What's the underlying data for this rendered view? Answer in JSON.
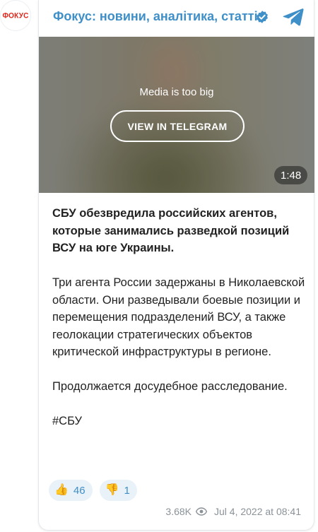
{
  "channel": {
    "name": "Фокус: новини, аналітика, статті",
    "avatar_text": "ФОКУС"
  },
  "media": {
    "notice": "Media is too big",
    "button_label": "VIEW IN TELEGRAM",
    "duration": "1:48"
  },
  "message": {
    "headline": "СБУ обезвредила российских агентов, которые занимались разведкой позиций ВСУ на юге Украины.",
    "paragraph1": "Три агента России задержаны в Николаевской области. Они разведывали боевые позиции и перемещения подразделений ВСУ, а также геолокации стратегических объектов критической инфраструктуры в регионе.",
    "paragraph2": "Продолжается досудебное расследование.",
    "hashtag": "#СБУ"
  },
  "reactions": [
    {
      "emoji": "👍",
      "count": "46"
    },
    {
      "emoji": "👎",
      "count": "1"
    }
  ],
  "footer": {
    "views": "3.68K",
    "date": "Jul 4, 2022 at 08:41"
  },
  "colors": {
    "accent": "#3f8fc8",
    "brand": "#e1251b",
    "verified": "#3f8fc8"
  },
  "icons": {
    "verified": "verified-badge-icon",
    "telegram": "telegram-logo-icon",
    "views": "eye-icon"
  }
}
